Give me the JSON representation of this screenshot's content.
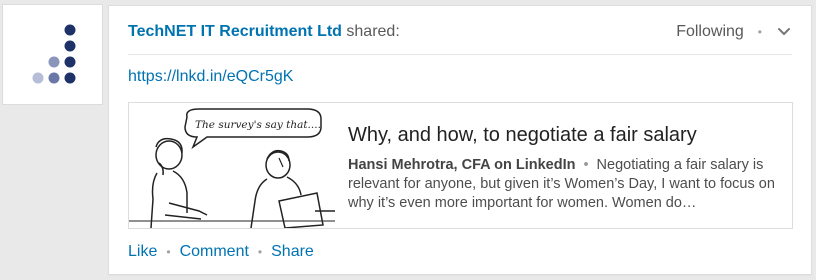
{
  "post": {
    "company_name": "TechNET IT Recruitment Ltd",
    "shared_text": "shared:",
    "following_label": "Following",
    "separator": "•",
    "link_text": "https://lnkd.in/eQCr5gK"
  },
  "article": {
    "image_caption": "The survey's say that....",
    "title": "Why, and how, to negotiate a fair salary",
    "author": "Hansi Mehrotra, CFA on LinkedIn",
    "separator": "•",
    "snippet": "Negotiating a fair salary is relevant for anyone, but given it’s Women’s Day, I want to focus on why it’s even more important for women. Women do…"
  },
  "actions": {
    "like": "Like",
    "comment": "Comment",
    "share": "Share",
    "separator": "•"
  },
  "colors": {
    "link_blue": "#0073b1",
    "logo_dark": "#1f3268",
    "logo_mid": "#6a78a8",
    "logo_light": "#b6bdd6"
  },
  "icons": {
    "menu": "chevron-down-icon",
    "logo": "company-logo"
  }
}
